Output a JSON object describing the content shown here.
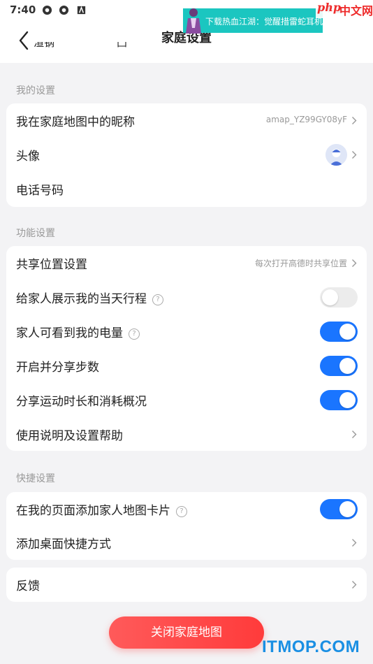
{
  "status_bar": {
    "time": "7:40",
    "right_text": "▼ ◢"
  },
  "banner_ad": {
    "text": "下载热血江湖：觉醒措雷蛇耳机"
  },
  "watermark_top": {
    "php": "php",
    "cn": "中文网"
  },
  "header": {
    "title": "家庭设置",
    "peek_left": "渲钢",
    "peek_right": "凸"
  },
  "my_settings": {
    "label": "我的设置",
    "nickname_label": "我在家庭地图中的昵称",
    "nickname_value": "amap_YZ99GY08yF",
    "avatar_label": "头像",
    "phone_label": "电话号码"
  },
  "function_settings": {
    "label": "功能设置",
    "share_location_label": "共享位置设置",
    "share_location_value": "每次打开高德时共享位置",
    "show_trip_label": "给家人展示我的当天行程",
    "show_trip_on": false,
    "battery_label": "家人可看到我的电量",
    "battery_on": true,
    "steps_label": "开启并分享步数",
    "steps_on": true,
    "exercise_label": "分享运动时长和消耗概况",
    "exercise_on": true,
    "help_label": "使用说明及设置帮助"
  },
  "quick_settings": {
    "label": "快捷设置",
    "add_card_label": "在我的页面添加家人地图卡片",
    "add_card_on": true,
    "shortcut_label": "添加桌面快捷方式"
  },
  "feedback": {
    "label": "反馈"
  },
  "close_button": {
    "label": "关闭家庭地图"
  },
  "watermark_bottom": {
    "text": "ITMOP.COM"
  },
  "colors": {
    "toggle_on": "#1a75ff",
    "close_button": "#ff4a4a"
  }
}
